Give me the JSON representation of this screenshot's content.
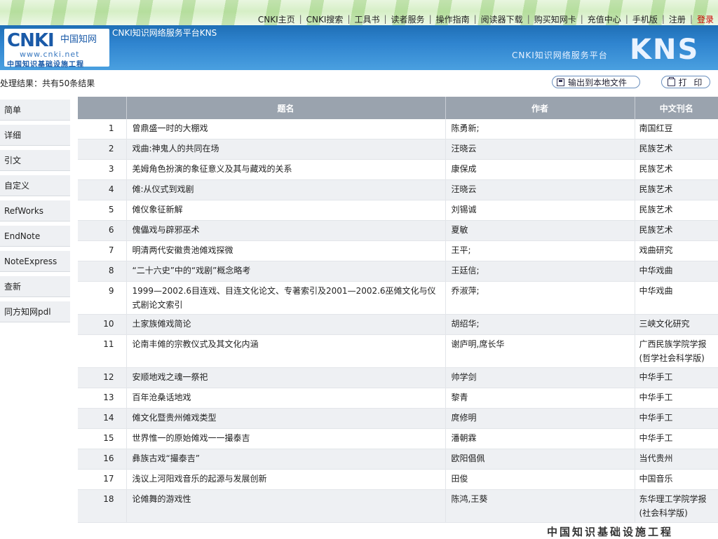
{
  "topnav": {
    "links": [
      "CNKI主页",
      "CNKI搜索",
      "工具书",
      "读者服务",
      "操作指南",
      "阅读器下载",
      "购买知网卡",
      "充值中心",
      "手机版",
      "注册"
    ],
    "login": "登录"
  },
  "header": {
    "platform_name": "CNKI知识网络服务平台KNS",
    "logo_cnki": "CNKI",
    "logo_cn_small": "中国知网",
    "logo_www": "www.cnki.net",
    "logo_cn_full": "中国知识基础设施工程",
    "platform_subtitle": "CNKI知识网络服务平台",
    "kns": "KNS"
  },
  "results": {
    "summary": "处理结果：共有50条结果",
    "export_label": "输出到本地文件",
    "print_label": "打 印"
  },
  "sidebar": {
    "items": [
      "简单",
      "详细",
      "引文",
      "自定义",
      "RefWorks",
      "EndNote",
      "NoteExpress",
      "查新",
      "同方知网pdl"
    ]
  },
  "table": {
    "headers": [
      "",
      "题名",
      "作者",
      "中文刊名"
    ],
    "rows": [
      {
        "n": "1",
        "title": "曾鼎盛一时的大棚戏",
        "author": "陈勇新;",
        "journal": "南国红豆"
      },
      {
        "n": "2",
        "title": "戏曲:神鬼人的共同在场",
        "author": "汪晓云",
        "journal": "民族艺术"
      },
      {
        "n": "3",
        "title": "羌姆角色扮演的象征意义及其与藏戏的关系",
        "author": "康保成",
        "journal": "民族艺术"
      },
      {
        "n": "4",
        "title": "傩:从仪式到戏剧",
        "author": "汪晓云",
        "journal": "民族艺术"
      },
      {
        "n": "5",
        "title": "傩仪象征新解",
        "author": "刘锡诚",
        "journal": "民族艺术"
      },
      {
        "n": "6",
        "title": "傀儡戏与辟邪巫术",
        "author": "夏敏",
        "journal": "民族艺术"
      },
      {
        "n": "7",
        "title": "明清两代安徽贵池傩戏探微",
        "author": "王平;",
        "journal": "戏曲研究"
      },
      {
        "n": "8",
        "title": "“二十六史”中的“戏剧”概念略考",
        "author": "王廷信;",
        "journal": "中华戏曲"
      },
      {
        "n": "9",
        "title": "1999—2002.6目连戏、目连文化论文、专著索引及2001—2002.6巫傩文化与仪式剧论文索引",
        "author": "乔淑萍;",
        "journal": "中华戏曲"
      },
      {
        "n": "10",
        "title": "土家族傩戏简论",
        "author": "胡绍华;",
        "journal": "三峡文化研究"
      },
      {
        "n": "11",
        "title": "论南丰傩的宗教仪式及其文化内涵",
        "author": "谢庐明,席长华",
        "journal": "广西民族学院学报(哲学社会科学版)"
      },
      {
        "n": "12",
        "title": "安顺地戏之魂一祭祀",
        "author": "帅学剑",
        "journal": "中华手工"
      },
      {
        "n": "13",
        "title": "百年沧桑话地戏",
        "author": "黎青",
        "journal": "中华手工"
      },
      {
        "n": "14",
        "title": "傩文化暨贵州傩戏类型",
        "author": "庹修明",
        "journal": "中华手工"
      },
      {
        "n": "15",
        "title": "世界惟一的原始傩戏一一撮泰吉",
        "author": "潘朝霖",
        "journal": "中华手工"
      },
      {
        "n": "16",
        "title": "彝族古戏“撮泰吉”",
        "author": "欧阳倡佩",
        "journal": "当代贵州"
      },
      {
        "n": "17",
        "title": "浅议上河阳戏音乐的起源与发展创新",
        "author": "田俊",
        "journal": "中国音乐"
      },
      {
        "n": "18",
        "title": "论傩舞的游戏性",
        "author": "陈鸿,王葵",
        "journal": "东华理工学院学报(社会科学版)"
      }
    ]
  },
  "footer": {
    "text": "中国知识基础设施工程"
  }
}
